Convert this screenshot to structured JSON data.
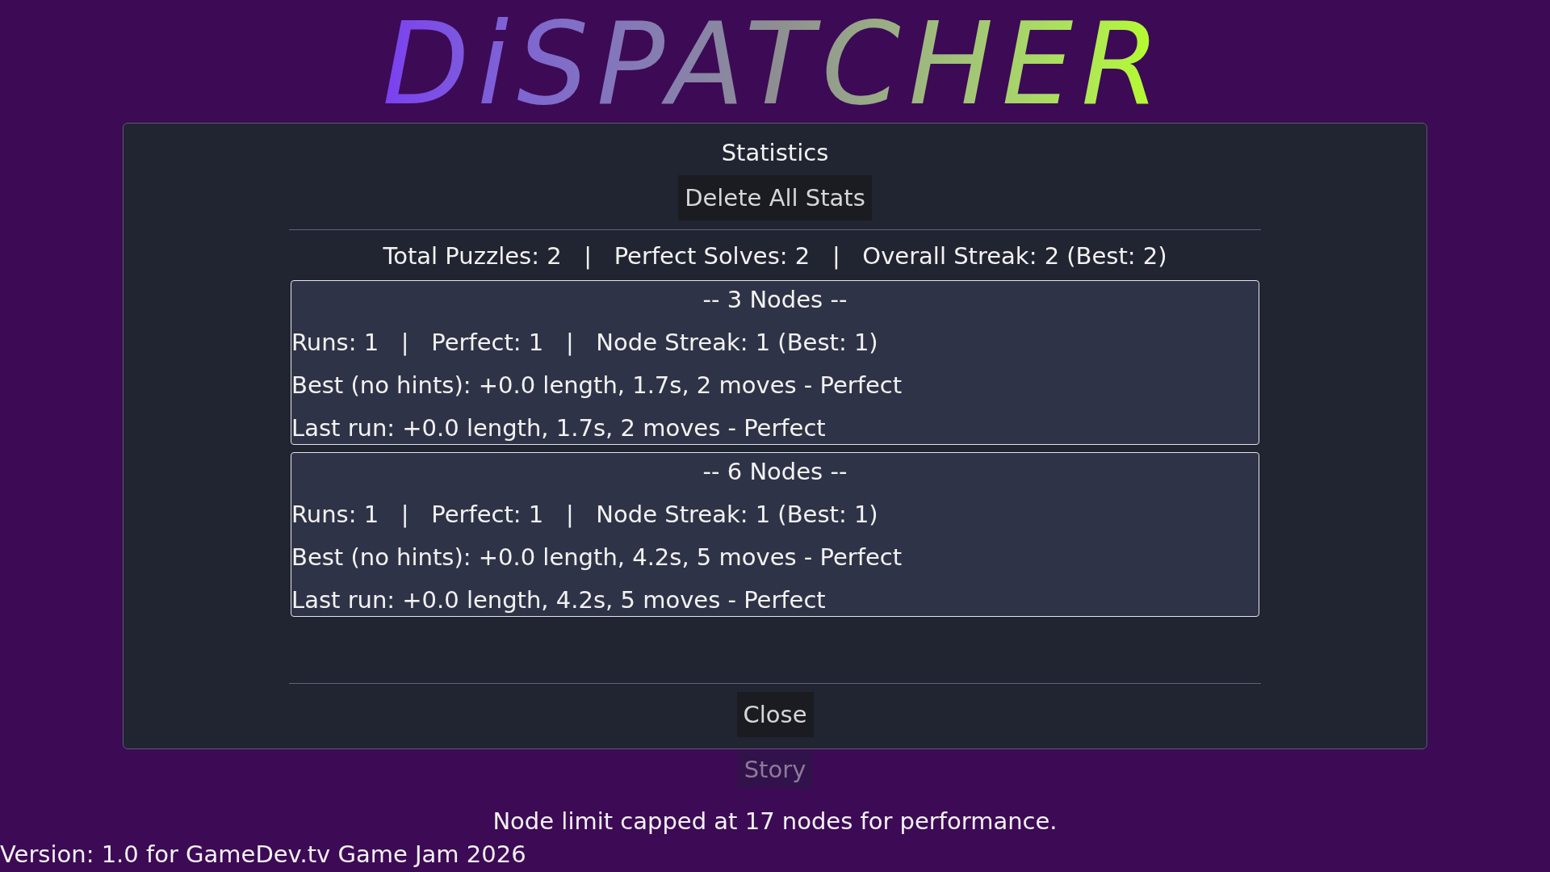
{
  "logo": "DiSPATCHER",
  "statistics_dialog": {
    "title": "Statistics",
    "delete_button": "Delete All Stats",
    "summary": "Total Puzzles: 2   |   Perfect Solves: 2   |   Overall Streak: 2 (Best: 2)",
    "node_groups": [
      {
        "heading": "-- 3 Nodes --",
        "lines": [
          "Runs: 1   |   Perfect: 1   |   Node Streak: 1 (Best: 1)",
          "Best (no hints): +0.0 length, 1.7s, 2 moves - Perfect",
          "Last run: +0.0 length, 1.7s, 2 moves - Perfect"
        ]
      },
      {
        "heading": "-- 6 Nodes --",
        "lines": [
          "Runs: 1   |   Perfect: 1   |   Node Streak: 1 (Best: 1)",
          "Best (no hints): +0.0 length, 4.2s, 5 moves - Perfect",
          "Last run: +0.0 length, 4.2s, 5 moves - Perfect"
        ]
      }
    ],
    "close_button": "Close"
  },
  "menu": {
    "buttons": [
      "Story"
    ]
  },
  "notice": "Node limit capped at 17 nodes for performance.",
  "version": "Version: 1.0 for GameDev.tv Game Jam 2026"
}
